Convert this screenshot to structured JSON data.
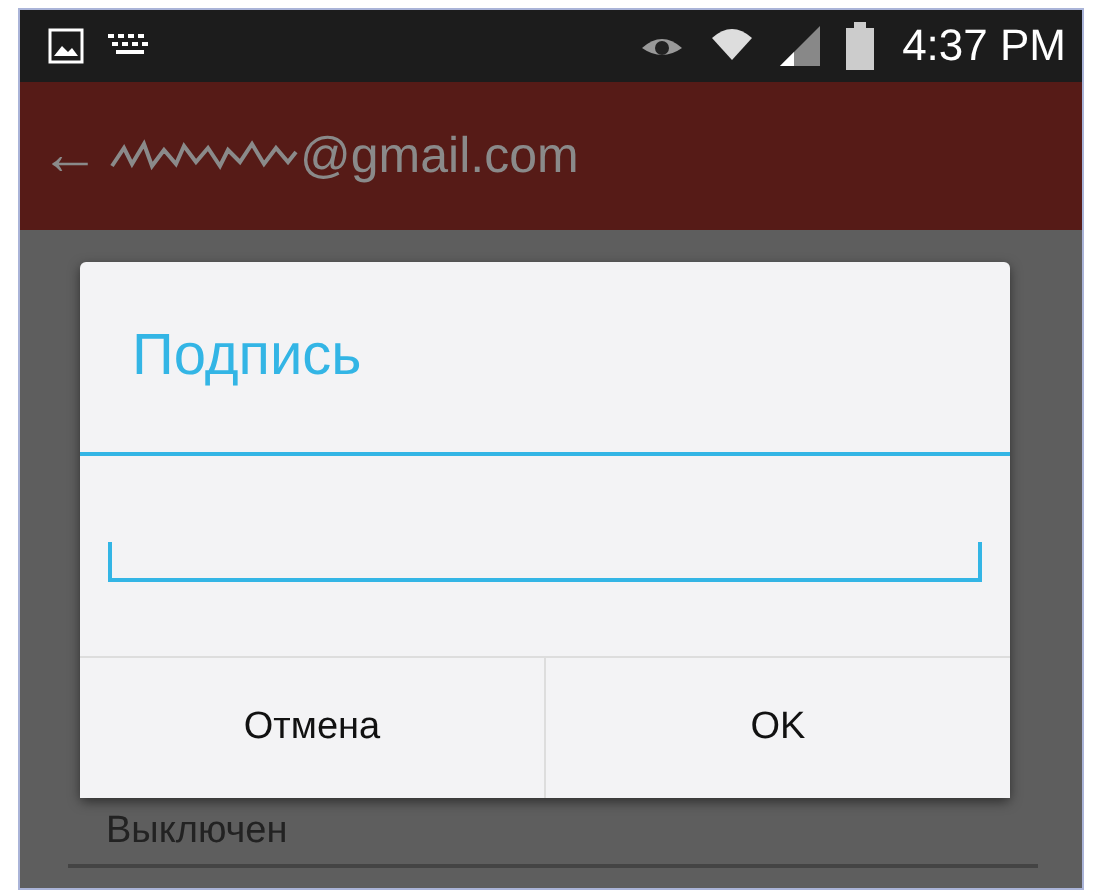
{
  "status_bar": {
    "time": "4:37 PM"
  },
  "app_bar": {
    "back": "←",
    "account": "@gmail.com"
  },
  "background": {
    "setting_value": "Выключен"
  },
  "dialog": {
    "title": "Подпись",
    "buttons": [
      {
        "label": "Отмена",
        "kind": "cancel"
      },
      {
        "label": "OK",
        "kind": "ok"
      }
    ]
  }
}
